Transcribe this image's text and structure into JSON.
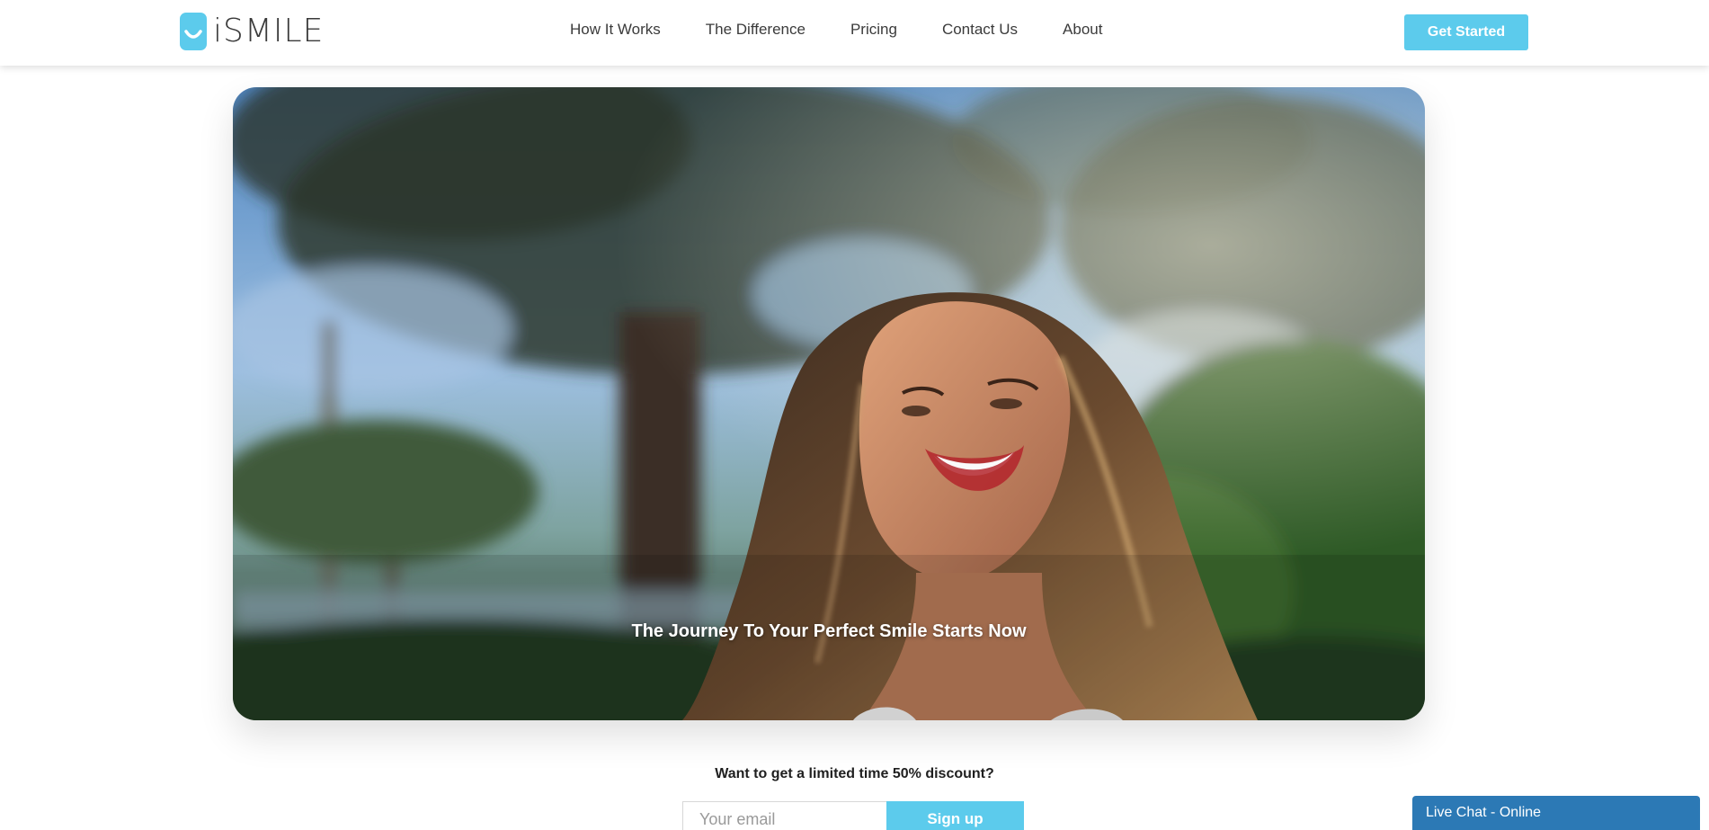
{
  "brand": {
    "name": "iSMILE",
    "accent_color": "#5ccbec",
    "chat_color": "#2c79b5"
  },
  "nav": {
    "items": [
      {
        "label": "How It Works"
      },
      {
        "label": "The Difference"
      },
      {
        "label": "Pricing"
      },
      {
        "label": "Contact Us"
      },
      {
        "label": "About"
      }
    ]
  },
  "header": {
    "cta_label": "Get Started"
  },
  "hero": {
    "caption": "The Journey To Your Perfect Smile Starts Now"
  },
  "discount": {
    "prompt": "Want to get a limited time 50% discount?",
    "email_placeholder": "Your email",
    "button_label": "Sign up"
  },
  "chat": {
    "label": "Live Chat - Online"
  }
}
